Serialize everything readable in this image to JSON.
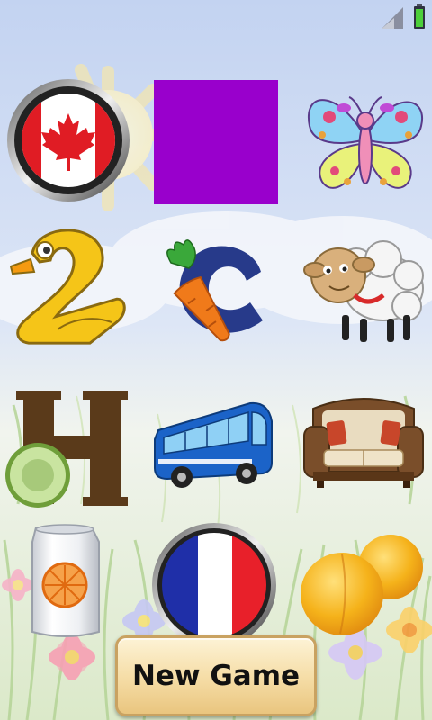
{
  "app": {
    "screen": "memory-match-board"
  },
  "status_bar": {
    "icons": [
      "signal-icon",
      "battery-icon"
    ]
  },
  "board": {
    "rows": 4,
    "cols": 3,
    "tiles": [
      {
        "name": "canada-flag",
        "face": "up"
      },
      {
        "name": "card-back",
        "face": "down",
        "color": "#9900cc"
      },
      {
        "name": "butterfly",
        "face": "up"
      },
      {
        "name": "number-two-duck",
        "face": "up"
      },
      {
        "name": "letter-c-carrot",
        "face": "up"
      },
      {
        "name": "sheep",
        "face": "up"
      },
      {
        "name": "letter-h-avocado",
        "face": "up"
      },
      {
        "name": "bus",
        "face": "up"
      },
      {
        "name": "sofa",
        "face": "up"
      },
      {
        "name": "soda-can",
        "face": "up"
      },
      {
        "name": "france-flag",
        "face": "up"
      },
      {
        "name": "apricots",
        "face": "up"
      }
    ]
  },
  "controls": {
    "new_game_label": "New Game"
  },
  "colors": {
    "card_back": "#9900cc",
    "sky": "#c8d8f2",
    "grass": "#dcedc8",
    "button": "#f5dca4"
  }
}
